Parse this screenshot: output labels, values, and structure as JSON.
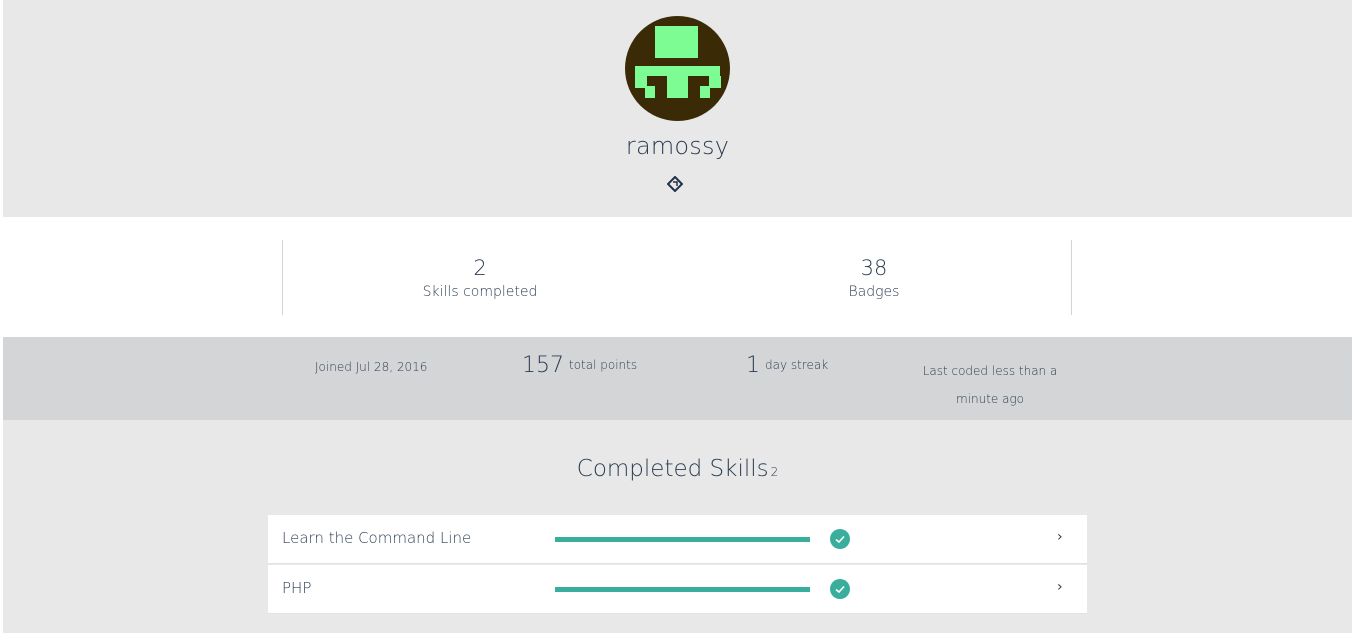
{
  "profile": {
    "username": "ramossy",
    "avatar_icon": "pixel-avatar-icon",
    "badge_icon": "diamond-badge-icon",
    "colors": {
      "avatar_bg": "#3a2a06",
      "avatar_fg": "#7dfc94"
    }
  },
  "stats": {
    "skills_value": "2",
    "skills_label": "Skills completed",
    "badges_value": "38",
    "badges_label": "Badges"
  },
  "info": {
    "joined": "Joined Jul 28, 2016",
    "points_value": "157",
    "points_label": "total points",
    "streak_value": "1",
    "streak_label": "day streak",
    "last_coded": "Last coded less than a minute ago"
  },
  "skills": {
    "title": "Completed Skills",
    "count": "2",
    "accent": "#3aae9c",
    "items": [
      {
        "name": "Learn the Command Line",
        "progress": 1.0,
        "icon": "check-icon",
        "chevron": "›"
      },
      {
        "name": "PHP",
        "progress": 1.0,
        "icon": "check-icon",
        "chevron": "›"
      }
    ]
  }
}
